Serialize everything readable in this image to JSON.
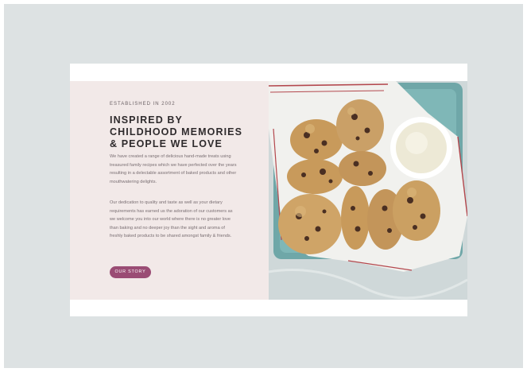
{
  "hero": {
    "eyebrow": "ESTABLISHED IN 2002",
    "headline_lines": [
      "INSPIRED BY",
      "CHILDHOOD MEMORIES",
      "& PEOPLE WE LOVE"
    ],
    "paragraph_1": "We have created a range of delicious hand-made treats using treasured family recipes which we have perfected over the years resulting in a delectable assortment of baked products and other mouthwatering delights.",
    "paragraph_2": "Our dedication to quality and taste as well as your dietary requirements has earned us the adoration of our customers as we welcome you into our world where there is no greater love than baking and no deeper joy than the sight and aroma of freshly baked products to be shared amongst family & friends.",
    "cta_label": "OUR STORY"
  },
  "colors": {
    "background": "#dde2e3",
    "text_panel": "#f2e9e8",
    "cta": "#9a4c74",
    "tray": "#6fa7a8"
  },
  "image": {
    "subject": "cookies-in-teal-tray-with-milk"
  }
}
